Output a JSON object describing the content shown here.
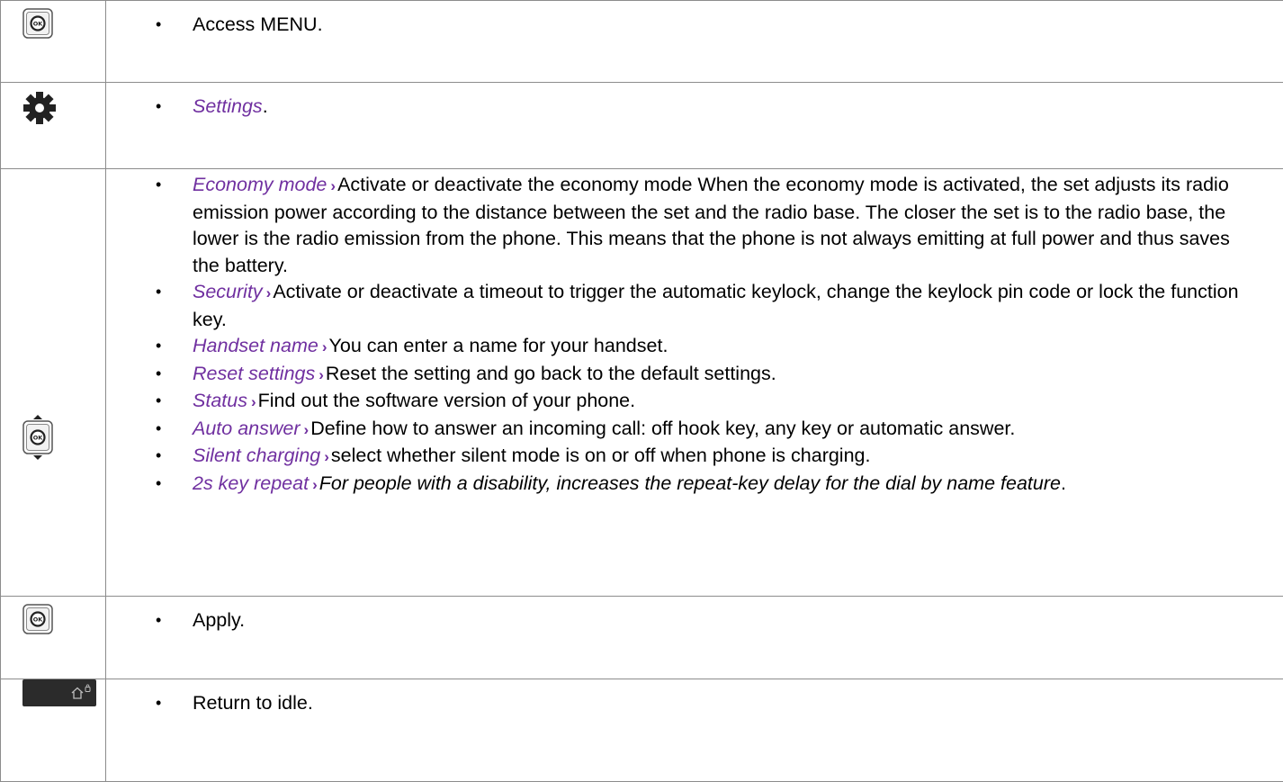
{
  "rows": {
    "access_menu": {
      "icon": "ok-key-icon",
      "text": "Access MENU."
    },
    "settings": {
      "icon": "gear-icon",
      "option": "Settings",
      "suffix": "."
    },
    "options": {
      "icon": "navigator-ok-up-down-icon",
      "arrow": "›",
      "items": [
        {
          "option": "Economy mode",
          "desc": "Activate or deactivate the economy mode When the economy mode is activated, the set adjusts its radio emission power according to the distance between the set and the radio base. The closer the set is to the radio base, the lower is the radio emission from the phone. This means that the phone is not always emitting at full power and thus saves the battery."
        },
        {
          "option": "Security",
          "desc": "Activate or deactivate a timeout to trigger the automatic keylock, change the keylock pin code or lock the function key."
        },
        {
          "option": "Handset name",
          "desc": "You can enter a name for your handset."
        },
        {
          "option": "Reset settings",
          "desc": "Reset the setting and go back to the default settings."
        },
        {
          "option": "Status",
          "desc": "Find out the software version of your phone."
        },
        {
          "option": "Auto answer",
          "desc": "Define how to answer an incoming call: off hook key, any key or automatic answer."
        },
        {
          "option": "Silent charging",
          "desc": "select whether silent mode is on or off when phone is charging."
        },
        {
          "option": "2s key repeat",
          "desc_italic": "For people with a disability, increases the repeat-key delay for the dial by name feature",
          "suffix": "."
        }
      ]
    },
    "apply": {
      "icon": "ok-key-icon",
      "text": "Apply."
    },
    "return_idle": {
      "icon": "home-lock-key-icon",
      "text": "Return to idle."
    }
  },
  "colors": {
    "option_text": "#7030a0",
    "border": "#8c8c8c"
  }
}
